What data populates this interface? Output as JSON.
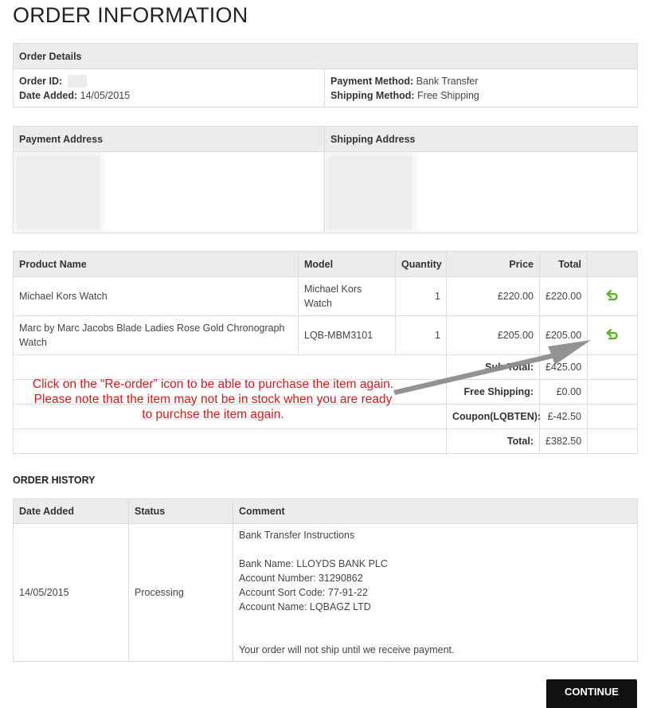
{
  "page_title": "ORDER INFORMATION",
  "order_details": {
    "header": "Order Details",
    "order_id_label": "Order ID:",
    "date_added_label": "Date Added:",
    "date_added_value": "14/05/2015",
    "payment_method_label": "Payment Method:",
    "payment_method_value": "Bank Transfer",
    "shipping_method_label": "Shipping Method:",
    "shipping_method_value": "Free Shipping"
  },
  "addresses": {
    "payment_header": "Payment Address",
    "shipping_header": "Shipping Address"
  },
  "products": {
    "columns": [
      "Product Name",
      "Model",
      "Quantity",
      "Price",
      "Total"
    ],
    "rows": [
      {
        "name": "Michael Kors Watch",
        "model": "Michael Kors Watch",
        "quantity": "1",
        "price": "£220.00",
        "total": "£220.00"
      },
      {
        "name": "Marc by Marc Jacobs Blade Ladies Rose Gold Chronograph Watch",
        "model": "LQB-MBM3101",
        "quantity": "1",
        "price": "£205.00",
        "total": "£205.00"
      }
    ],
    "totals": [
      {
        "label": "Sub-Total:",
        "value": "£425.00"
      },
      {
        "label": "Free Shipping:",
        "value": "£0.00"
      },
      {
        "label": "Coupon(LQBTEN):",
        "value": "£-42.50"
      },
      {
        "label": "Total:",
        "value": "£382.50"
      }
    ],
    "reorder_icon": "reorder-icon",
    "reorder_icon_color": "#5db12b"
  },
  "annotation": {
    "lines": [
      "Click on the “Re-order” icon to be able to purchase the item again.",
      "Please note that the item may not be in stock when you are ready",
      "to purchse the item again."
    ],
    "color": "#cc1b1b"
  },
  "order_history": {
    "title": "ORDER HISTORY",
    "columns": [
      "Date Added",
      "Status",
      "Comment"
    ],
    "row": {
      "date": "14/05/2015",
      "status": "Processing",
      "comment_lines": [
        "Bank Transfer Instructions",
        "",
        "Bank Name: LLOYDS BANK PLC",
        "Account Number: 31290862",
        "Account Sort Code: 77-91-22",
        "Account Name: LQBAGZ LTD",
        "",
        "",
        "Your order will not ship until we receive payment."
      ]
    }
  },
  "continue_label": "CONTINUE"
}
